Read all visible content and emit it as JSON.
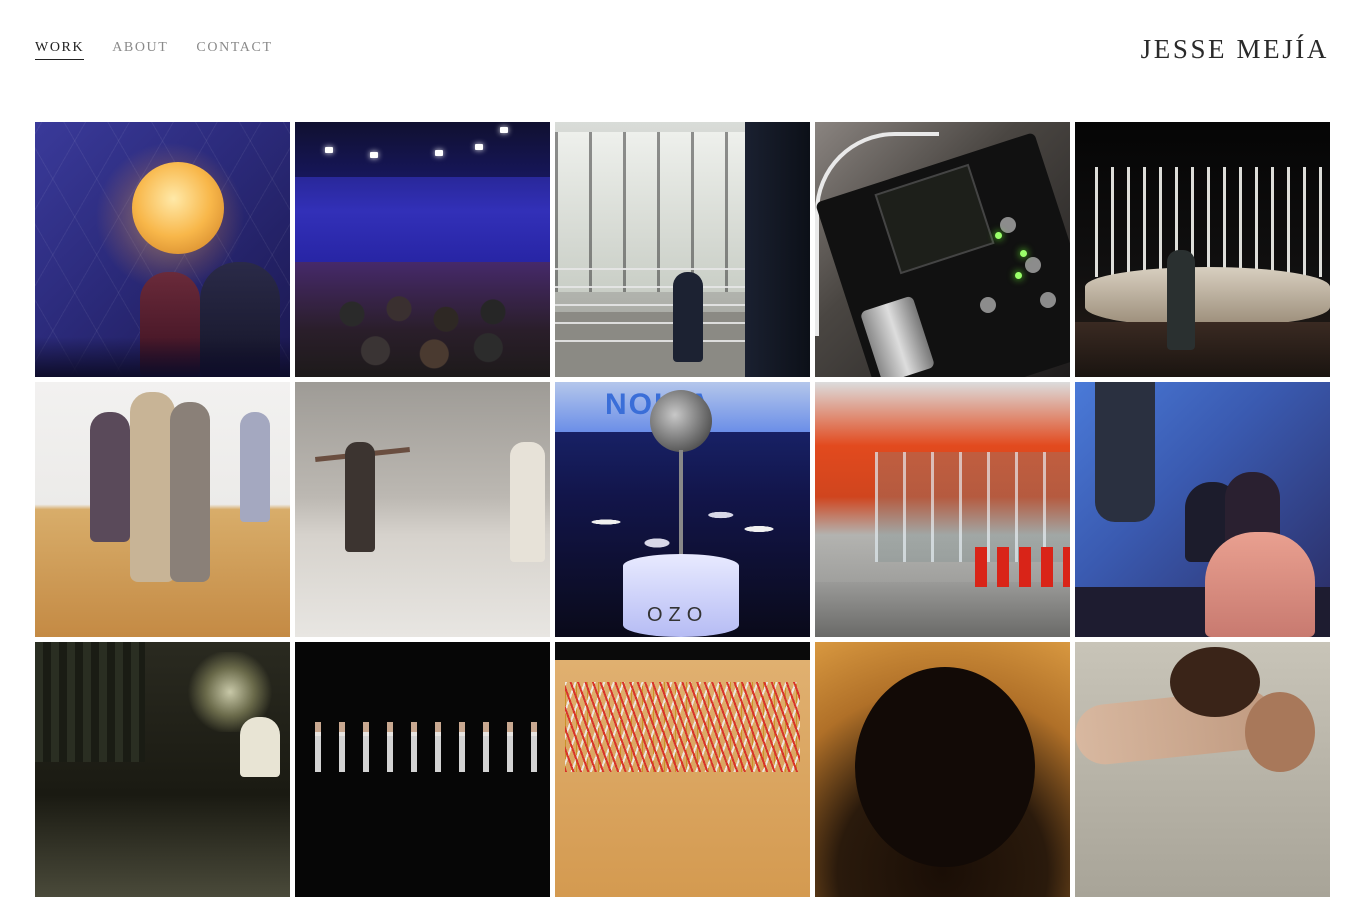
{
  "nav": {
    "items": [
      {
        "label": "WORK",
        "active": true
      },
      {
        "label": "ABOUT",
        "active": false
      },
      {
        "label": "CONTACT",
        "active": false
      }
    ]
  },
  "site": {
    "title": "JESSE MEJÍA"
  },
  "gallery": {
    "tiles": [
      {
        "subject": "dome-glowing-sphere"
      },
      {
        "subject": "blue-stage-audience"
      },
      {
        "subject": "glass-lobby-performer"
      },
      {
        "subject": "circuit-board"
      },
      {
        "subject": "night-pole-installation"
      },
      {
        "subject": "dancers-wood-floor"
      },
      {
        "subject": "dancers-grey-studio"
      },
      {
        "subject": "ozo-camera",
        "sign_text": "NOKIA",
        "pedestal_text": "OZO"
      },
      {
        "subject": "red-lobby"
      },
      {
        "subject": "seated-group-blue"
      },
      {
        "subject": "dark-interior-figure"
      },
      {
        "subject": "stage-performers-dark"
      },
      {
        "subject": "wires-patch"
      },
      {
        "subject": "silhouette-head"
      },
      {
        "subject": "dancer-motion"
      }
    ]
  },
  "colors": {
    "nav_active": "#222222",
    "nav_inactive": "#8a8a8a",
    "title": "#2a2a2a",
    "background": "#ffffff"
  }
}
